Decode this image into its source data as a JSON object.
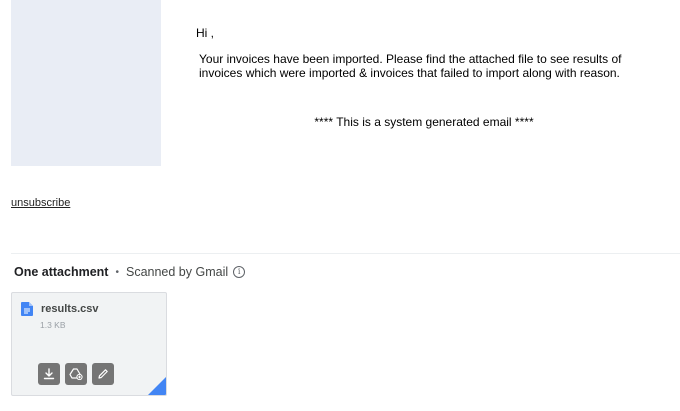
{
  "email": {
    "greeting": "Hi ,",
    "message_line1": "Your invoices have been imported. Please find the attached file to see results of",
    "message_line2": "invoices which were imported & invoices that failed to import along with reason.",
    "system_note": "**** This is a system generated email ****",
    "unsubscribe_label": "unsubscribe"
  },
  "attachments": {
    "count_label": "One attachment",
    "separator": "•",
    "scan_label": "Scanned by Gmail",
    "info_glyph": "i",
    "items": [
      {
        "file_name": "results.csv",
        "file_size": "1.3 KB",
        "file_icon": "document-icon",
        "actions": [
          "download-icon",
          "add-to-drive-icon",
          "edit-icon"
        ]
      }
    ]
  },
  "colors": {
    "logo_panel": "#e9edf5",
    "file_icon": "#4285f4",
    "action_button": "#757575"
  }
}
